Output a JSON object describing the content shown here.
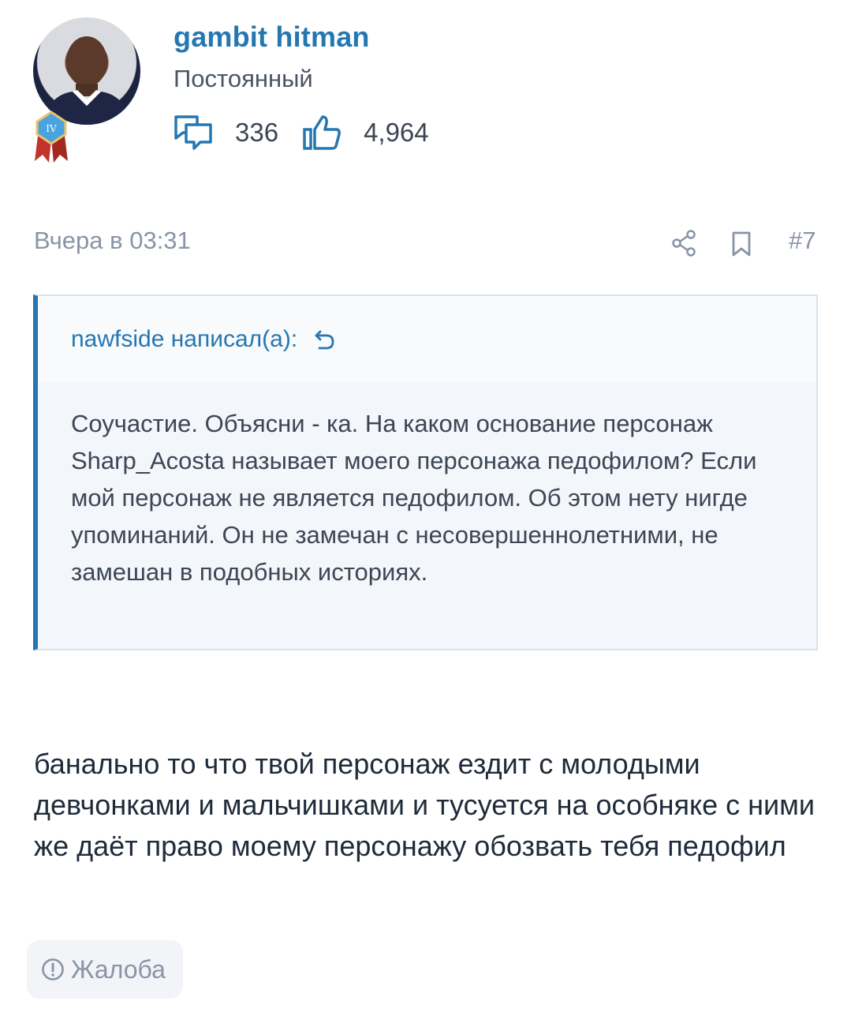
{
  "user": {
    "name": "gambit hitman",
    "title": "Постоянный",
    "badge_label": "IV",
    "messages_count": "336",
    "reactions_count": "4,964"
  },
  "post": {
    "date": "Вчера в 03:31",
    "number": "#7",
    "quote_author": "nawfside написал(а):",
    "quote_text": "Соучастие. Объясни - ка. На каком основание персонаж Sharp_Acosta называет моего персонажа педофилом? Если мой персонаж не является педофилом. Об этом нету нигде упоминаний. Он не замечан с несовершеннолетними, не замешан в подобных историях.",
    "message": "банально то что твой персонаж ездит с молодыми девчонками и мальчишками и тусуется на особняке с ними же даёт право моему персонажу обозвать тебя педофил",
    "report_label": "Жалоба"
  },
  "icons": {
    "messages": "speech-bubbles-icon",
    "reactions": "thumbs-up-icon",
    "share": "share-icon",
    "bookmark": "bookmark-icon",
    "quote_jump": "arrow-up-back-icon",
    "report": "exclamation-circle-icon"
  },
  "colors": {
    "accent": "#2577b1",
    "muted": "#8a94a6",
    "quote_bg": "#f3f6fb",
    "badge_red": "#c0342b",
    "badge_blue": "#4aa3df"
  }
}
